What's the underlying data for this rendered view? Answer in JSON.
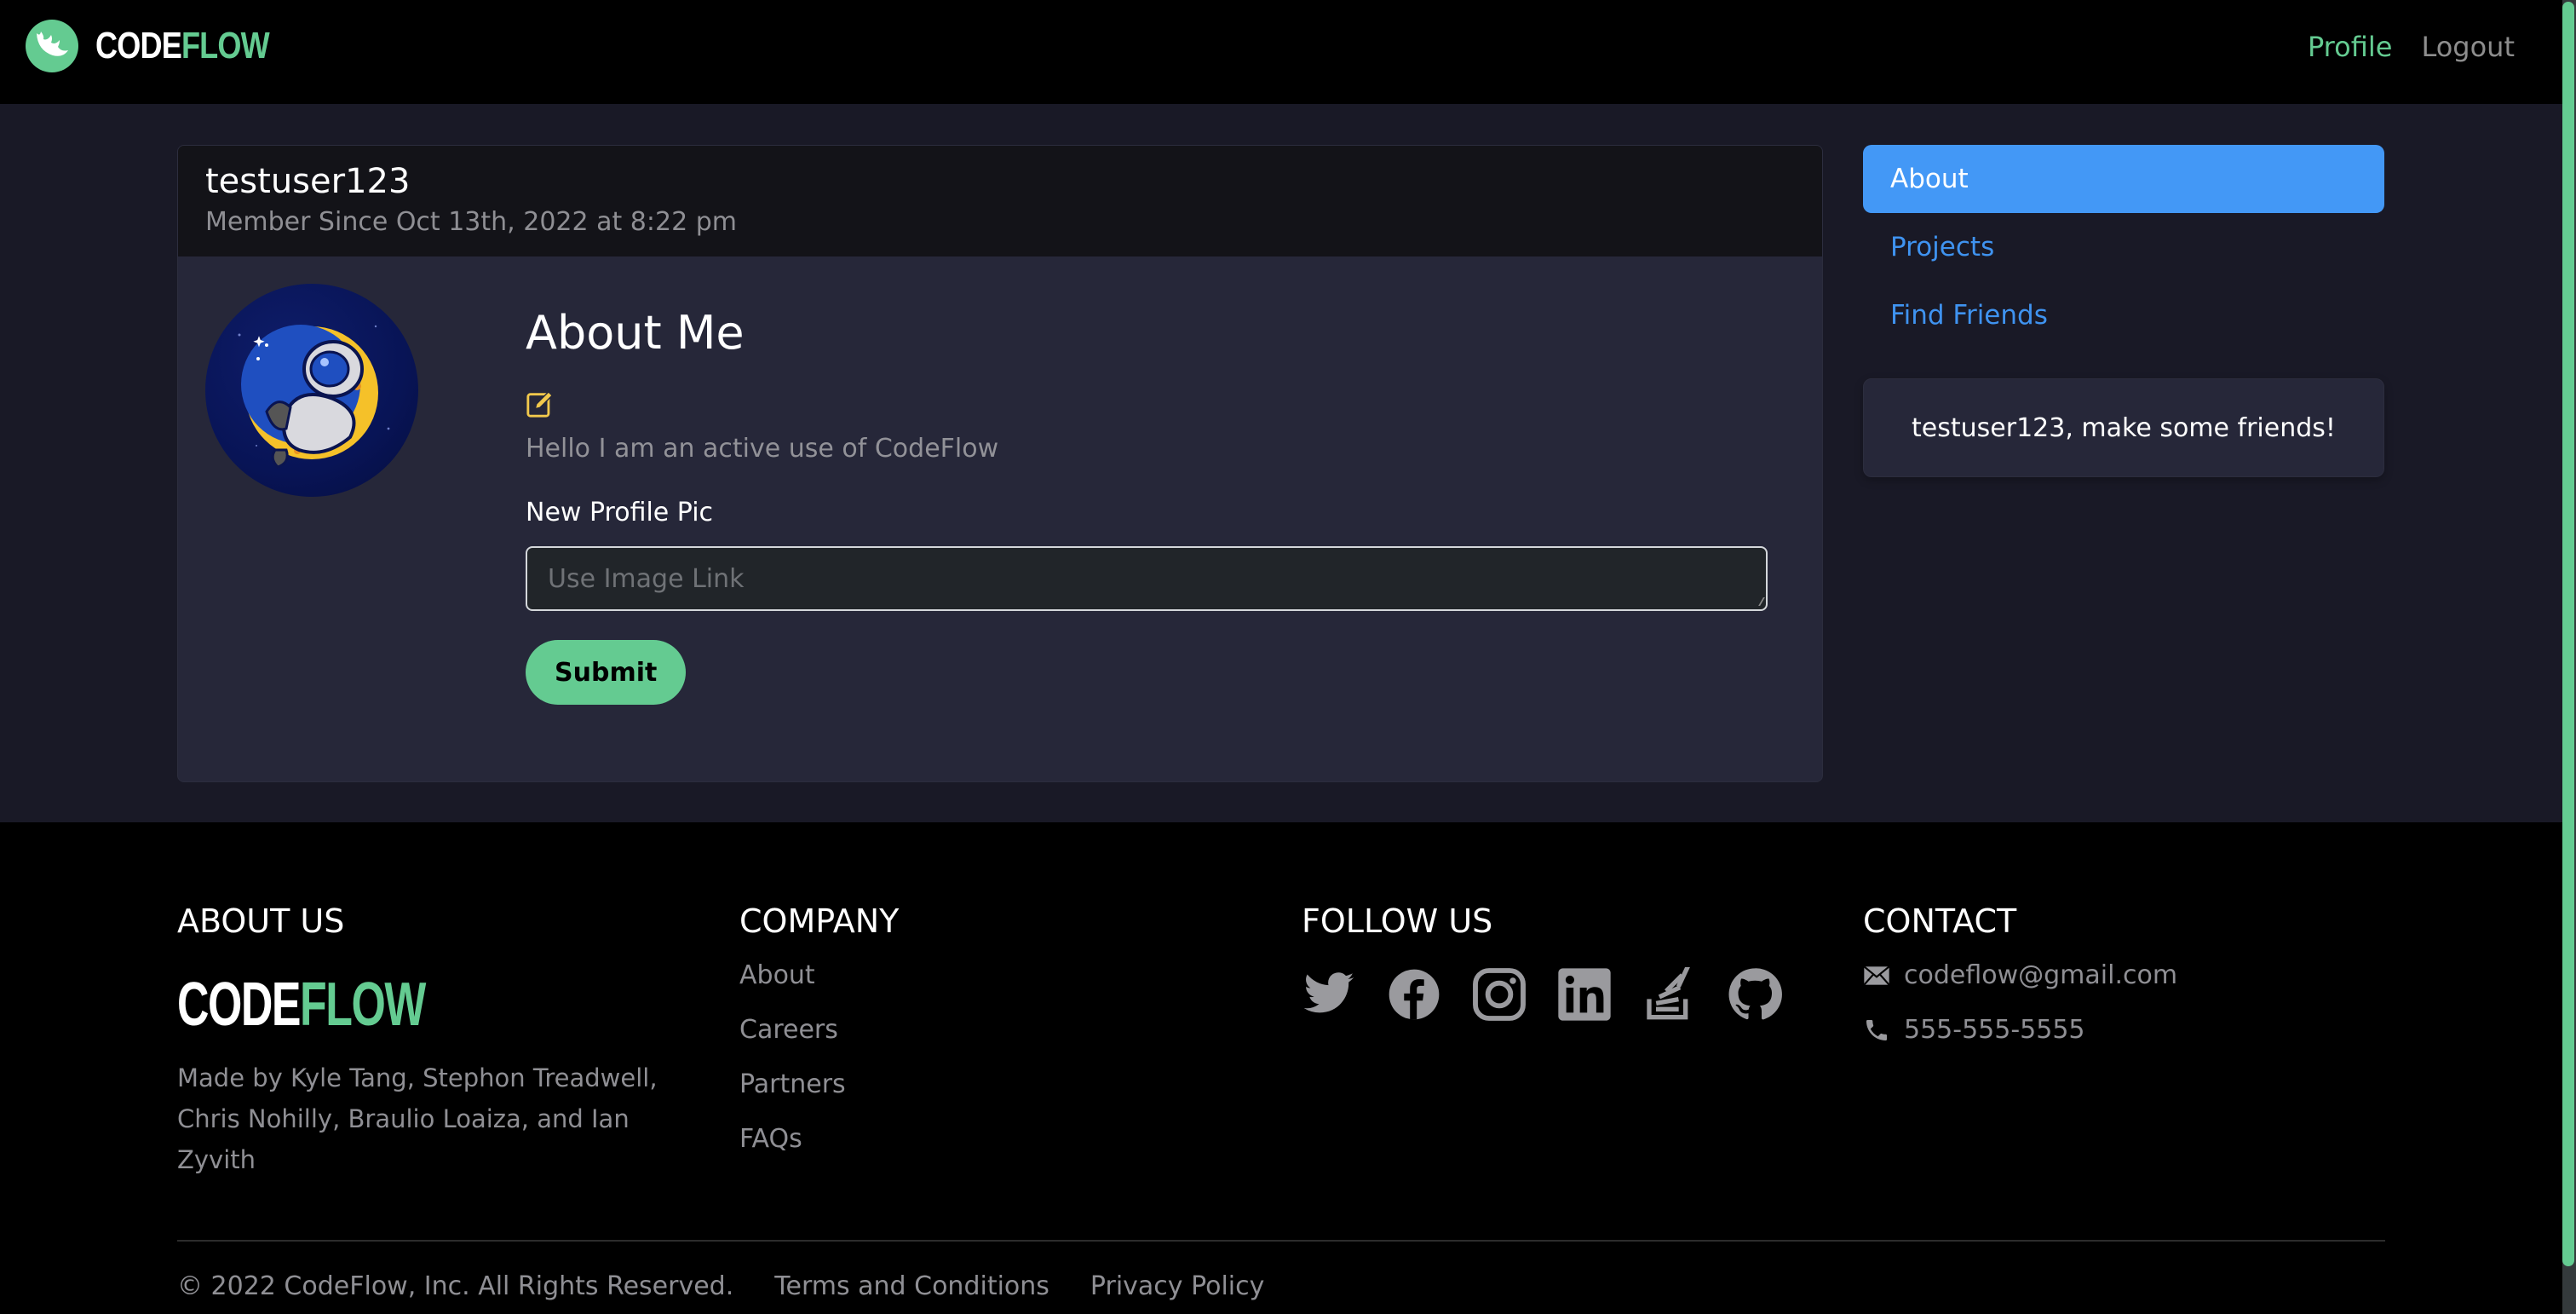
{
  "header": {
    "brand_code": "CODE",
    "brand_flow": "FLOW",
    "nav": [
      {
        "label": "Profile",
        "active": true
      },
      {
        "label": "Logout",
        "active": false
      }
    ]
  },
  "profile": {
    "username": "testuser123",
    "member_since": "Member Since Oct 13th, 2022 at 8:22 pm",
    "about_title": "About Me",
    "edit_icon": "edit-icon",
    "bio": "Hello I am an active use of CodeFlow",
    "new_pic_label": "New Profile Pic",
    "pic_input": {
      "value": "",
      "placeholder": "Use Image Link"
    },
    "submit_label": "Submit"
  },
  "sidebar": {
    "items": [
      {
        "label": "About",
        "active": true
      },
      {
        "label": "Projects",
        "active": false
      },
      {
        "label": "Find Friends",
        "active": false
      }
    ],
    "friends_message": "testuser123, make some friends!"
  },
  "footer": {
    "about": {
      "heading": "ABOUT US",
      "brand_code": "CODE",
      "brand_flow": "FLOW",
      "made_by": "Made by Kyle Tang, Stephon Treadwell, Chris Nohilly, Braulio Loaiza, and Ian Zyvith"
    },
    "company": {
      "heading": "COMPANY",
      "links": [
        "About",
        "Careers",
        "Partners",
        "FAQs"
      ]
    },
    "follow": {
      "heading": "FOLLOW US",
      "icons": [
        "twitter-icon",
        "facebook-icon",
        "instagram-icon",
        "linkedin-icon",
        "stackoverflow-icon",
        "github-icon"
      ]
    },
    "contact": {
      "heading": "CONTACT",
      "email": "codeflow@gmail.com",
      "phone": "555-555-5555"
    },
    "copyright": "© 2022 CodeFlow, Inc. All Rights Reserved.",
    "terms": "Terms and Conditions",
    "privacy": "Privacy Policy"
  },
  "colors": {
    "brand_green": "#64cb91",
    "accent_blue": "#4398f6",
    "edit_yellow": "#f2c94c"
  }
}
